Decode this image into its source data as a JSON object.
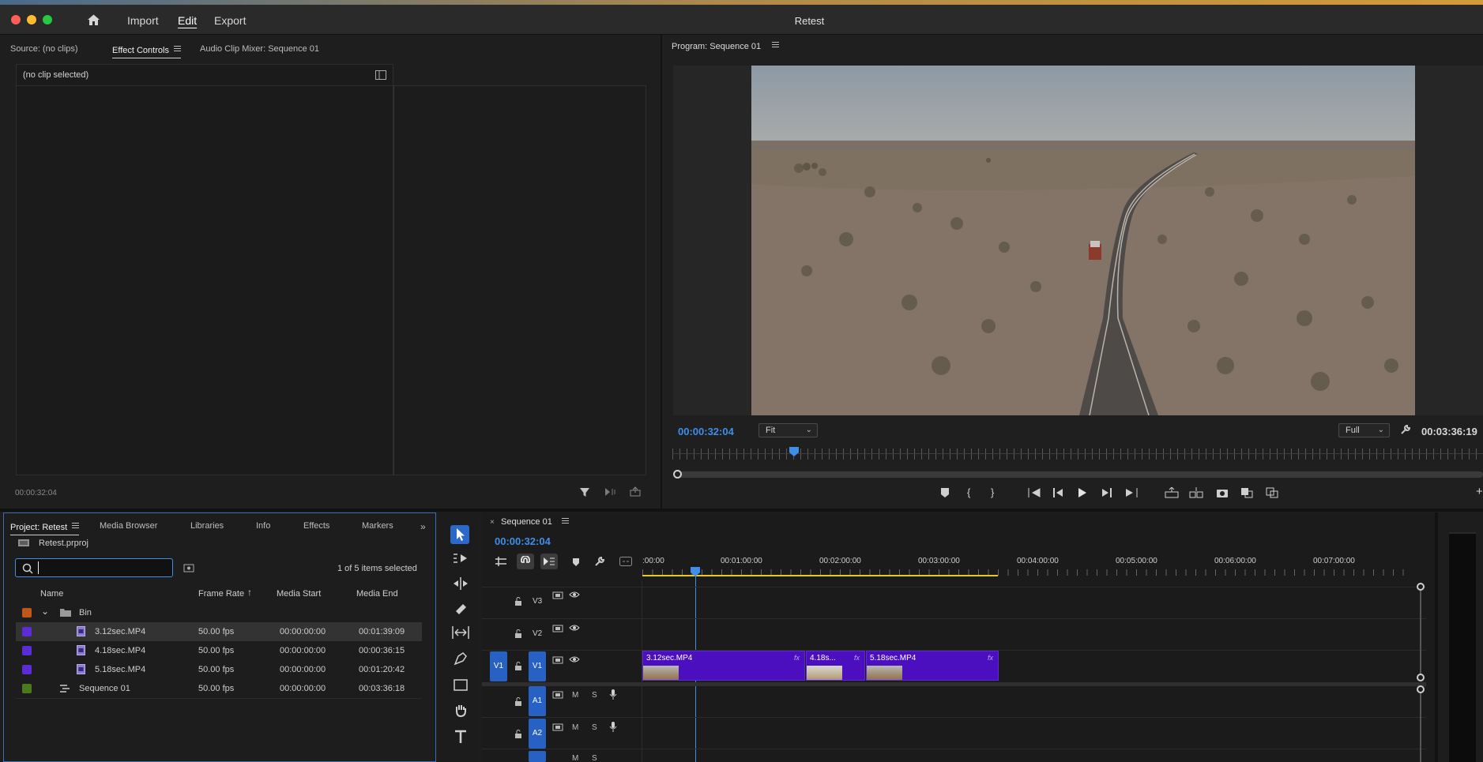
{
  "app": {
    "title": "Retest",
    "menu": [
      "Import",
      "Edit",
      "Export"
    ],
    "active_menu": "Edit"
  },
  "source_panel": {
    "tabs": [
      "Source: (no clips)",
      "Effect Controls",
      "Audio Clip Mixer: Sequence 01"
    ],
    "active_tab": "Effect Controls",
    "no_clip_text": "(no clip selected)",
    "timecode": "00:00:32:04"
  },
  "program_monitor": {
    "title": "Program: Sequence 01",
    "current_timecode": "00:00:32:04",
    "fit_option": "Fit",
    "resolution_option": "Full",
    "duration_timecode": "00:03:36:19"
  },
  "project_panel": {
    "tabs": [
      "Project: Retest",
      "Media Browser",
      "Libraries",
      "Info",
      "Effects",
      "Markers"
    ],
    "active_tab": "Project: Retest",
    "project_file": "Retest.prproj",
    "search_value": "",
    "selection_info": "1 of 5 items selected",
    "columns": [
      "Name",
      "Frame Rate",
      "Media Start",
      "Media End"
    ],
    "items": [
      {
        "name": "Bin",
        "type": "bin",
        "frame_rate": "",
        "media_start": "",
        "media_end": "",
        "color": "#c0571a"
      },
      {
        "name": "3.12sec.MP4",
        "type": "clip",
        "frame_rate": "50.00 fps",
        "media_start": "00:00:00:00",
        "media_end": "00:01:39:09",
        "color": "#5a2dd6"
      },
      {
        "name": "4.18sec.MP4",
        "type": "clip",
        "frame_rate": "50.00 fps",
        "media_start": "00:00:00:00",
        "media_end": "00:00:36:15",
        "color": "#5a2dd6"
      },
      {
        "name": "5.18sec.MP4",
        "type": "clip",
        "frame_rate": "50.00 fps",
        "media_start": "00:00:00:00",
        "media_end": "00:01:20:42",
        "color": "#5a2dd6"
      },
      {
        "name": "Sequence 01",
        "type": "sequence",
        "frame_rate": "50.00 fps",
        "media_start": "00:00:00:00",
        "media_end": "00:03:36:18",
        "color": "#4b7a1e"
      }
    ]
  },
  "timeline": {
    "sequence_tab": "Sequence 01",
    "timecode": "00:00:32:04",
    "ruler_labels": [
      ":00:00",
      "00:01:00:00",
      "00:02:00:00",
      "00:03:00:00",
      "00:04:00:00",
      "00:05:00:00",
      "00:06:00:00",
      "00:07:00:00"
    ],
    "video_tracks": [
      "V3",
      "V2",
      "V1"
    ],
    "audio_tracks": [
      "A1",
      "A2"
    ],
    "source_patch": "V1",
    "track_button_m": "M",
    "track_button_s": "S",
    "clips": [
      {
        "name": "3.12sec.MP4",
        "fx": "fx"
      },
      {
        "name": "4.18s...",
        "fx": "fx"
      },
      {
        "name": "5.18sec.MP4",
        "fx": "fx"
      }
    ]
  }
}
